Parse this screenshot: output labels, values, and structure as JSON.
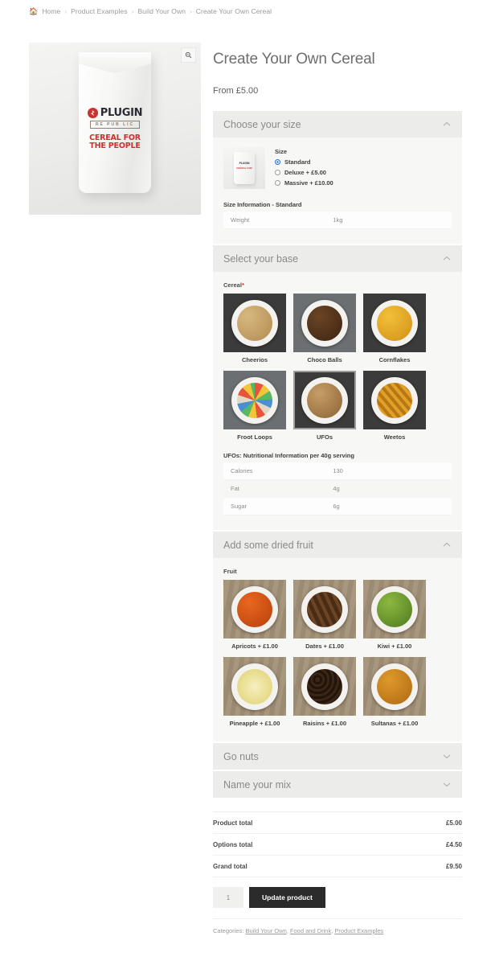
{
  "breadcrumb": {
    "home_icon": "home-icon",
    "items": [
      {
        "label": "Home"
      },
      {
        "label": "Product Examples"
      },
      {
        "label": "Build Your Own"
      },
      {
        "label": "Create Your Own Cereal"
      }
    ],
    "separator": "›"
  },
  "gallery": {
    "zoom_icon": "⌕",
    "product_brand": "PLUGIN",
    "product_banner": "RE PUB LIC",
    "product_tagline": "CEREAL FOR\nTHE PEOPLE",
    "tagline_line1": "CEREAL FOR",
    "tagline_line2": "THE PEOPLE"
  },
  "product": {
    "title": "Create Your Own Cereal",
    "price_from": "From £5.00"
  },
  "accordion": {
    "size": {
      "title": "Choose your size",
      "chevron": "⌃",
      "expanded": true,
      "field_legend": "Size",
      "options": [
        {
          "label": "Standard",
          "checked": true
        },
        {
          "label": "Deluxe + £5.00",
          "checked": false
        },
        {
          "label": "Massive + £10.00",
          "checked": false
        }
      ],
      "info_title": "Size Information - Standard",
      "info_rows": [
        {
          "name": "Weight",
          "value": "1kg"
        }
      ]
    },
    "base": {
      "title": "Select your base",
      "chevron": "⌃",
      "expanded": true,
      "field_label": "Cereal",
      "required_marker": "*",
      "options": [
        {
          "label": "Cheerios",
          "selected": false,
          "swatch": "gr-cheerios",
          "bg": "bg-dark"
        },
        {
          "label": "Choco Balls",
          "selected": false,
          "swatch": "gr-choco",
          "bg": "bg-slate"
        },
        {
          "label": "Cornflakes",
          "selected": false,
          "swatch": "gr-corn",
          "bg": "bg-dark"
        },
        {
          "label": "Froot Loops",
          "selected": false,
          "swatch": "gr-froot",
          "bg": "bg-slate"
        },
        {
          "label": "UFOs",
          "selected": true,
          "swatch": "gr-ufos",
          "bg": "bg-dark"
        },
        {
          "label": "Weetos",
          "selected": false,
          "swatch": "gr-weetos",
          "bg": "bg-dark"
        }
      ],
      "nutrition_title": "UFOs: Nutritional Information per 40g serving",
      "nutrition_rows": [
        {
          "name": "Calories",
          "value": "130"
        },
        {
          "name": "Fat",
          "value": "4g"
        },
        {
          "name": "Sugar",
          "value": "6g"
        }
      ]
    },
    "fruit": {
      "title": "Add some dried fruit",
      "chevron": "⌃",
      "expanded": true,
      "field_label": "Fruit",
      "options": [
        {
          "label": "Apricots + £1.00",
          "selected": false,
          "swatch": "gr-apricot",
          "bg": "bg-wood"
        },
        {
          "label": "Dates + £1.00",
          "selected": false,
          "swatch": "gr-dates",
          "bg": "bg-wood"
        },
        {
          "label": "Kiwi + £1.00",
          "selected": false,
          "swatch": "gr-kiwi",
          "bg": "bg-wood"
        },
        {
          "label": "Pineapple + £1.00",
          "selected": false,
          "swatch": "gr-pineapple",
          "bg": "bg-wood"
        },
        {
          "label": "Raisins + £1.00",
          "selected": false,
          "swatch": "gr-raisins",
          "bg": "bg-wood"
        },
        {
          "label": "Sultanas + £1.00",
          "selected": false,
          "swatch": "gr-sultanas",
          "bg": "bg-wood"
        }
      ]
    },
    "nuts": {
      "title": "Go nuts",
      "chevron": "⌄",
      "expanded": false
    },
    "name_mix": {
      "title": "Name your mix",
      "chevron": "⌄",
      "expanded": false
    }
  },
  "totals": {
    "rows": [
      {
        "label": "Product total",
        "amount": "£5.00"
      },
      {
        "label": "Options total",
        "amount": "£4.50"
      },
      {
        "label": "Grand total",
        "amount": "£9.50"
      }
    ]
  },
  "cart": {
    "quantity": "1",
    "quantity_placeholder": "1",
    "update_label": "Update product"
  },
  "meta": {
    "categories_label": "Categories:",
    "categories": [
      {
        "label": "Build Your Own"
      },
      {
        "label": "Food and Drink"
      },
      {
        "label": "Product Examples"
      }
    ]
  }
}
